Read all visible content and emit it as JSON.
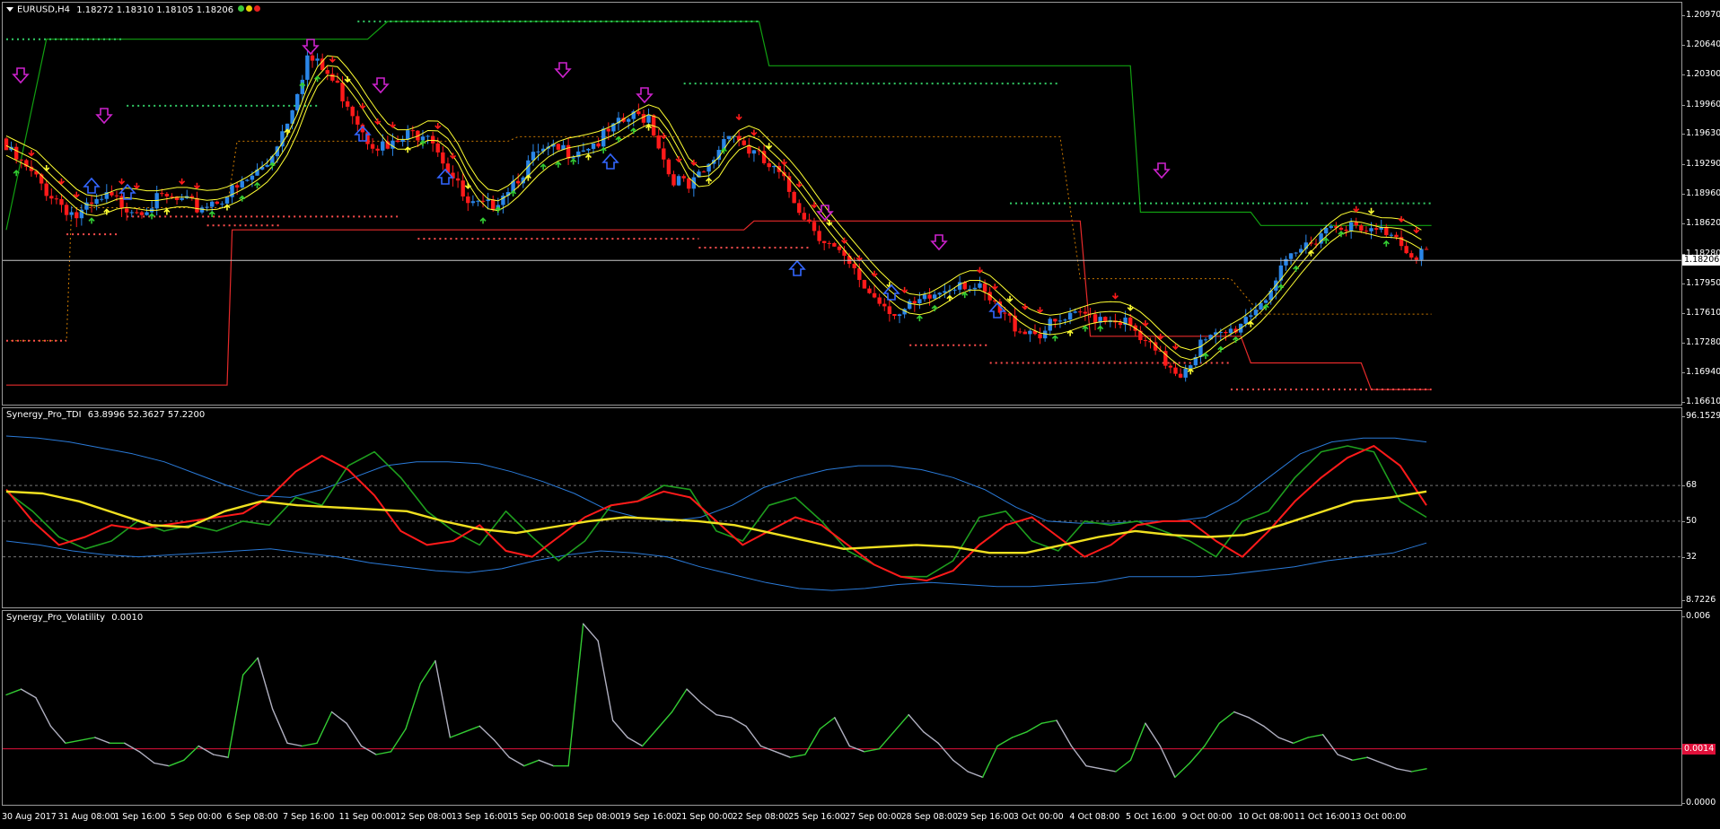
{
  "main_pane": {
    "symbol": "EURUSD,H4",
    "ohlc": "1.18272 1.18310 1.18105 1.18206",
    "status_colors": [
      "#3cc83c",
      "#e6d200",
      "#e62020"
    ],
    "price_ticks": [
      "1.20970",
      "1.20640",
      "1.20300",
      "1.19960",
      "1.19630",
      "1.19290",
      "1.18960",
      "1.18620",
      "1.18280",
      "1.17950",
      "1.17610",
      "1.17280",
      "1.16940",
      "1.16610"
    ],
    "current_price": "1.18206",
    "colors": {
      "bull": "#2a86e8",
      "bear": "#ff1a1a",
      "ma": "#ffff33",
      "res": "#33cc66",
      "sup": "#ff4d4d",
      "trend_green": "#11a011",
      "trend_red": "#e62a2a",
      "sell_arrow": "#cc22cc",
      "buy_arrow": "#3366ff",
      "orange": "#cc7a00"
    }
  },
  "td_pane": {
    "name": "Synergy_Pro_TDI",
    "values": "63.8996 52.3627 57.2200",
    "axis_ticks": [
      "96.1529",
      "68",
      "50",
      "32",
      "8.7226"
    ],
    "colors": {
      "band": "#2a7ad8",
      "rsi": "#1e9e1e",
      "signal": "#ff1a1a",
      "base": "#f0e020"
    }
  },
  "vol_pane": {
    "name": "Synergy_Pro_Volatility",
    "value": "0.0010",
    "axis_ticks": [
      "0.006",
      "0.0000"
    ],
    "level": "0.0014",
    "colors": {
      "low": "#b0b0c0",
      "high": "#33cc33",
      "level": "#e0103a"
    }
  },
  "time_axis": [
    "30 Aug 2017",
    "31 Aug 08:00",
    "1 Sep 16:00",
    "5 Sep 00:00",
    "6 Sep 08:00",
    "7 Sep 16:00",
    "11 Sep 00:00",
    "12 Sep 08:00",
    "13 Sep 16:00",
    "15 Sep 00:00",
    "18 Sep 08:00",
    "19 Sep 16:00",
    "21 Sep 00:00",
    "22 Sep 08:00",
    "25 Sep 16:00",
    "27 Sep 00:00",
    "28 Sep 08:00",
    "29 Sep 16:00",
    "3 Oct 00:00",
    "4 Oct 08:00",
    "5 Oct 16:00",
    "9 Oct 00:00",
    "10 Oct 08:00",
    "11 Oct 16:00",
    "13 Oct 00:00"
  ],
  "chart_data": [
    {
      "type": "candlestick",
      "title": "EURUSD,H4",
      "ylim": [
        1.1661,
        1.2097
      ],
      "x_labels": [
        "30 Aug 2017",
        "31 Aug 08:00",
        "1 Sep 16:00",
        "5 Sep 00:00",
        "6 Sep 08:00",
        "7 Sep 16:00",
        "11 Sep 00:00",
        "12 Sep 08:00",
        "13 Sep 16:00",
        "15 Sep 00:00",
        "18 Sep 08:00",
        "19 Sep 16:00",
        "21 Sep 00:00",
        "22 Sep 08:00",
        "25 Sep 16:00",
        "27 Sep 00:00",
        "28 Sep 08:00",
        "29 Sep 16:00",
        "3 Oct 00:00",
        "4 Oct 08:00",
        "5 Oct 16:00",
        "9 Oct 00:00",
        "10 Oct 08:00",
        "11 Oct 16:00",
        "13 Oct 00:00"
      ],
      "close_path": [
        {
          "bar": 0,
          "close": 1.195
        },
        {
          "bar": 8,
          "close": 1.1905
        },
        {
          "bar": 14,
          "close": 1.1875
        },
        {
          "bar": 20,
          "close": 1.1895
        },
        {
          "bar": 26,
          "close": 1.1885
        },
        {
          "bar": 32,
          "close": 1.1895
        },
        {
          "bar": 38,
          "close": 1.1885
        },
        {
          "bar": 46,
          "close": 1.1905
        },
        {
          "bar": 52,
          "close": 1.1935
        },
        {
          "bar": 56,
          "close": 1.1985
        },
        {
          "bar": 60,
          "close": 1.2055
        },
        {
          "bar": 64,
          "close": 1.2035
        },
        {
          "bar": 68,
          "close": 1.2005
        },
        {
          "bar": 72,
          "close": 1.1965
        },
        {
          "bar": 76,
          "close": 1.195
        },
        {
          "bar": 80,
          "close": 1.1965
        },
        {
          "bar": 84,
          "close": 1.1975
        },
        {
          "bar": 88,
          "close": 1.193
        },
        {
          "bar": 92,
          "close": 1.1885
        },
        {
          "bar": 96,
          "close": 1.1885
        },
        {
          "bar": 100,
          "close": 1.191
        },
        {
          "bar": 106,
          "close": 1.1945
        },
        {
          "bar": 112,
          "close": 1.195
        },
        {
          "bar": 118,
          "close": 1.196
        },
        {
          "bar": 124,
          "close": 1.1985
        },
        {
          "bar": 128,
          "close": 1.199
        },
        {
          "bar": 132,
          "close": 1.1925
        },
        {
          "bar": 136,
          "close": 1.1905
        },
        {
          "bar": 140,
          "close": 1.193
        },
        {
          "bar": 144,
          "close": 1.1975
        },
        {
          "bar": 148,
          "close": 1.195
        },
        {
          "bar": 154,
          "close": 1.192
        },
        {
          "bar": 160,
          "close": 1.187
        },
        {
          "bar": 166,
          "close": 1.183
        },
        {
          "bar": 172,
          "close": 1.179
        },
        {
          "bar": 178,
          "close": 1.1765
        },
        {
          "bar": 182,
          "close": 1.1775
        },
        {
          "bar": 186,
          "close": 1.179
        },
        {
          "bar": 190,
          "close": 1.1805
        },
        {
          "bar": 194,
          "close": 1.179
        },
        {
          "bar": 198,
          "close": 1.1765
        },
        {
          "bar": 202,
          "close": 1.175
        },
        {
          "bar": 206,
          "close": 1.1745
        },
        {
          "bar": 210,
          "close": 1.1755
        },
        {
          "bar": 216,
          "close": 1.1765
        },
        {
          "bar": 222,
          "close": 1.176
        },
        {
          "bar": 226,
          "close": 1.1735
        },
        {
          "bar": 230,
          "close": 1.1715
        },
        {
          "bar": 234,
          "close": 1.17
        },
        {
          "bar": 238,
          "close": 1.173
        },
        {
          "bar": 244,
          "close": 1.1745
        },
        {
          "bar": 250,
          "close": 1.178
        },
        {
          "bar": 256,
          "close": 1.1825
        },
        {
          "bar": 262,
          "close": 1.186
        },
        {
          "bar": 266,
          "close": 1.187
        },
        {
          "bar": 270,
          "close": 1.1855
        },
        {
          "bar": 276,
          "close": 1.186
        },
        {
          "bar": 280,
          "close": 1.1835
        }
      ],
      "levels": {
        "resistance": [
          1.209,
          1.202,
          1.1995,
          1.1885
        ],
        "support": [
          1.1855,
          1.1835,
          1.1705,
          1.1675
        ]
      }
    },
    {
      "type": "line",
      "title": "Synergy_Pro_TDI",
      "ylim": [
        8.7226,
        96.1529
      ],
      "reference_levels": [
        68,
        50,
        32
      ],
      "x_labels": [
        "30 Aug 2017",
        "31 Aug 08:00",
        "1 Sep 16:00",
        "5 Sep 00:00",
        "6 Sep 08:00",
        "7 Sep 16:00",
        "11 Sep 00:00",
        "12 Sep 08:00",
        "13 Sep 16:00",
        "15 Sep 00:00",
        "18 Sep 08:00",
        "19 Sep 16:00",
        "21 Sep 00:00",
        "22 Sep 08:00",
        "25 Sep 16:00",
        "27 Sep 00:00",
        "28 Sep 08:00",
        "29 Sep 16:00",
        "3 Oct 00:00",
        "4 Oct 08:00",
        "5 Oct 16:00",
        "9 Oct 00:00",
        "10 Oct 08:00",
        "11 Oct 16:00",
        "13 Oct 00:00"
      ],
      "series": [
        {
          "values": [
            93,
            92,
            90,
            87,
            84,
            80,
            74,
            68,
            63,
            62,
            66,
            72,
            78,
            80,
            80,
            79,
            75,
            70,
            64,
            56,
            52,
            50,
            52,
            58,
            67,
            72,
            76,
            78,
            78,
            76,
            72,
            66,
            57,
            50,
            49,
            49,
            50,
            50,
            52,
            60,
            72,
            84,
            90,
            92,
            92,
            90
          ]
        },
        {
          "values": [
            40,
            38,
            35,
            33,
            32,
            33,
            34,
            35,
            36,
            34,
            32,
            29,
            27,
            25,
            24,
            26,
            30,
            33,
            35,
            34,
            32,
            27,
            23,
            19,
            16,
            15,
            16,
            18,
            19,
            18,
            17,
            17,
            18,
            19,
            22,
            22,
            22,
            23,
            25,
            27,
            30,
            32,
            34,
            39
          ]
        },
        {
          "values": [
            65,
            55,
            42,
            36,
            40,
            50,
            45,
            48,
            45,
            50,
            48,
            62,
            58,
            78,
            85,
            72,
            55,
            45,
            38,
            55,
            42,
            30,
            40,
            58,
            60,
            68,
            66,
            45,
            40,
            58,
            62,
            50,
            35,
            28,
            22,
            22,
            30,
            52,
            55,
            40,
            35,
            50,
            48,
            50,
            45,
            40,
            32,
            50,
            55,
            72,
            85,
            88,
            85,
            60,
            52
          ]
        },
        {
          "values": [
            66,
            50,
            38,
            42,
            48,
            46,
            48,
            50,
            52,
            54,
            62,
            75,
            83,
            76,
            63,
            45,
            38,
            40,
            48,
            35,
            32,
            42,
            52,
            58,
            60,
            65,
            62,
            50,
            38,
            45,
            52,
            48,
            38,
            28,
            22,
            20,
            25,
            38,
            48,
            52,
            42,
            32,
            38,
            48,
            50,
            50,
            40,
            32,
            45,
            60,
            72,
            82,
            88,
            78,
            58
          ]
        },
        {
          "values": [
            65,
            64,
            60,
            54,
            48,
            47,
            55,
            60,
            58,
            57,
            56,
            55,
            50,
            46,
            44,
            47,
            50,
            52,
            51,
            50,
            48,
            44,
            40,
            36,
            37,
            38,
            37,
            34,
            34,
            38,
            42,
            45,
            43,
            42,
            43,
            48,
            54,
            60,
            62,
            65
          ]
        }
      ]
    },
    {
      "type": "line",
      "title": "Synergy_Pro_Volatility",
      "ylim": [
        0,
        0.006
      ],
      "level": 0.0014,
      "x_labels": [
        "30 Aug 2017",
        "31 Aug 08:00",
        "1 Sep 16:00",
        "5 Sep 00:00",
        "6 Sep 08:00",
        "7 Sep 16:00",
        "11 Sep 00:00",
        "12 Sep 08:00",
        "13 Sep 16:00",
        "15 Sep 00:00",
        "18 Sep 08:00",
        "19 Sep 16:00",
        "21 Sep 00:00",
        "22 Sep 08:00",
        "25 Sep 16:00",
        "27 Sep 00:00",
        "28 Sep 08:00",
        "29 Sep 16:00",
        "3 Oct 00:00",
        "4 Oct 08:00",
        "5 Oct 16:00",
        "9 Oct 00:00",
        "10 Oct 08:00",
        "11 Oct 16:00",
        "13 Oct 00:00"
      ],
      "series": [
        {
          "values": [
            0.0033,
            0.0035,
            0.0032,
            0.0022,
            0.0016,
            0.0017,
            0.0018,
            0.0016,
            0.0016,
            0.0013,
            0.0009,
            0.0008,
            0.001,
            0.0015,
            0.0012,
            0.0011,
            0.004,
            0.0046,
            0.0028,
            0.0016,
            0.0015,
            0.0016,
            0.0027,
            0.0023,
            0.0015,
            0.0012,
            0.0013,
            0.0021,
            0.0037,
            0.0045,
            0.0018,
            0.002,
            0.0022,
            0.0017,
            0.0011,
            0.0008,
            0.001,
            0.0008,
            0.0008,
            0.0058,
            0.0052,
            0.0024,
            0.0018,
            0.0015,
            0.0021,
            0.0027,
            0.0035,
            0.003,
            0.0026,
            0.0025,
            0.0022,
            0.0015,
            0.0013,
            0.0011,
            0.0012,
            0.0021,
            0.0025,
            0.0015,
            0.0013,
            0.0014,
            0.002,
            0.0026,
            0.002,
            0.0016,
            0.001,
            0.0006,
            0.0004,
            0.0015,
            0.0018,
            0.002,
            0.0023,
            0.0024,
            0.0015,
            0.0008,
            0.0007,
            0.0006,
            0.001,
            0.0023,
            0.0015,
            0.0004,
            0.0009,
            0.0015,
            0.0023,
            0.0027,
            0.0025,
            0.0022,
            0.0018,
            0.0016,
            0.0018,
            0.0019,
            0.0012,
            0.001,
            0.0011,
            0.0009,
            0.0007,
            0.0006,
            0.0007
          ]
        }
      ]
    }
  ]
}
